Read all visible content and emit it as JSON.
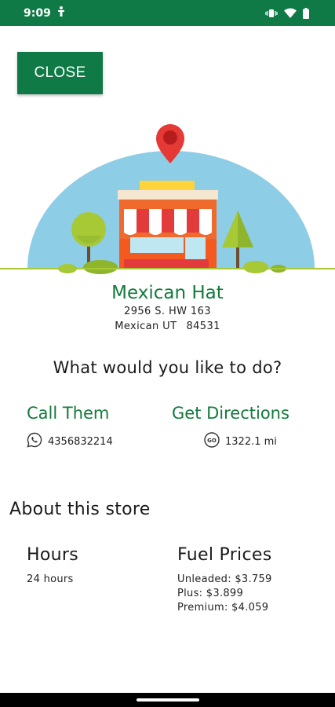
{
  "status_bar": {
    "time": "9:09",
    "background": "#0f7a45",
    "icons": [
      "accessibility-icon",
      "vibrate-icon",
      "wifi-icon",
      "battery-icon"
    ]
  },
  "close_button": {
    "label": "CLOSE"
  },
  "illustration": {
    "icons": [
      "map-pin-icon",
      "storefront-icon",
      "tree-icon"
    ],
    "sky_color": "#8ecde6",
    "ground_color": "#a7c936"
  },
  "store": {
    "name": "Mexican Hat",
    "address_line1": "2956 S. HW 163",
    "city_state": "Mexican UT",
    "zip": "84531"
  },
  "question": "What would you like to do?",
  "actions": {
    "call": {
      "title": "Call Them",
      "phone": "4356832214",
      "icon": "whatsapp-icon"
    },
    "directions": {
      "title": "Get Directions",
      "distance": "1322.1 mi",
      "icon": "directions-icon"
    }
  },
  "about": {
    "title": "About this store",
    "hours": {
      "heading": "Hours",
      "value": "24 hours"
    },
    "fuel": {
      "heading": "Fuel Prices",
      "lines": [
        "Unleaded: $3.759",
        "Plus: $3.899",
        "Premium: $4.059"
      ]
    }
  },
  "accent_color": "#137a3c"
}
